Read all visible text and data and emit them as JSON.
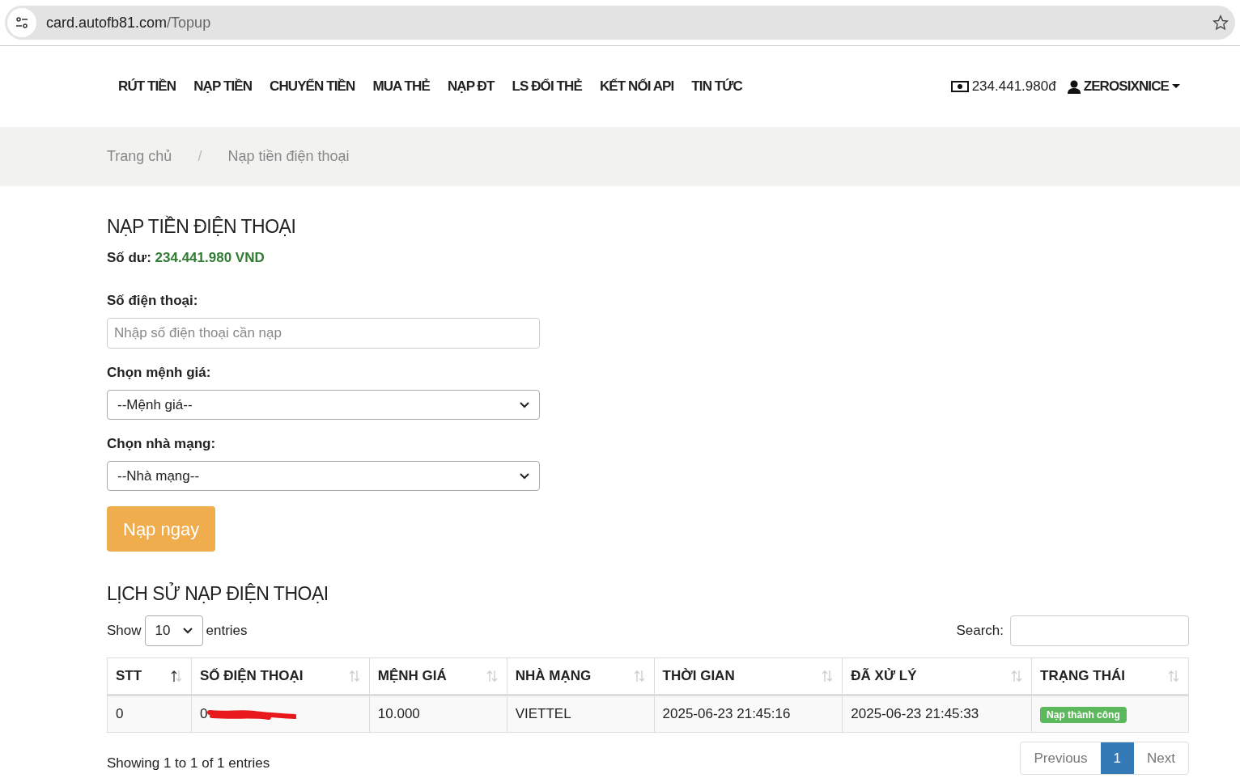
{
  "browser": {
    "url_host": "card.autofb81.com",
    "url_path": "/Topup"
  },
  "nav": {
    "items": [
      "RÚT TIỀN",
      "NẠP TIỀN",
      "CHUYỂN TIỀN",
      "MUA THẺ",
      "NẠP ĐT",
      "LS ĐỔI THẺ",
      "KẾT NỐI API",
      "TIN TỨC"
    ],
    "balance": "234.441.980đ",
    "user": "ZEROSIXNICE"
  },
  "breadcrumb": {
    "items": [
      "Trang chủ",
      "Nạp tiền điện thoại"
    ],
    "separator": "/"
  },
  "form": {
    "title": "NẠP TIỀN ĐIỆN THOẠI",
    "balance_label": "Số dư:",
    "balance_value": "234.441.980 VND",
    "fields": [
      {
        "kind": "input",
        "label": "Số điện thoại:",
        "placeholder": "Nhập số điện thoại cần nạp"
      },
      {
        "kind": "select",
        "label": "Chọn mệnh giá:",
        "value": "--Mệnh giá--"
      },
      {
        "kind": "select",
        "label": "Chọn nhà mạng:",
        "value": "--Nhà mạng--"
      }
    ],
    "submit": "Nạp ngay"
  },
  "history": {
    "title": "LỊCH SỬ NẠP ĐIỆN THOẠI",
    "show_label": "Show",
    "page_size": "10",
    "entries_label": "entries",
    "search_label": "Search:",
    "columns": [
      {
        "label": "STT",
        "sorted": true
      },
      {
        "label": "SỐ ĐIỆN THOẠI",
        "sorted": false
      },
      {
        "label": "MỆNH GIÁ",
        "sorted": false
      },
      {
        "label": "NHÀ MẠNG",
        "sorted": false
      },
      {
        "label": "THỜI GIAN",
        "sorted": false
      },
      {
        "label": "ĐÃ XỬ LÝ",
        "sorted": false
      },
      {
        "label": "TRẠNG THÁI",
        "sorted": false
      }
    ],
    "rows": [
      {
        "cells": [
          {
            "text": "0",
            "redacted": false
          },
          {
            "text": "0",
            "redacted": true
          },
          {
            "text": "10.000",
            "redacted": false
          },
          {
            "text": "VIETTEL",
            "redacted": false
          },
          {
            "text": "2025-06-23 21:45:16",
            "redacted": false
          },
          {
            "text": "2025-06-23 21:45:33",
            "redacted": false
          }
        ],
        "status": "Nạp thành công",
        "color": "#5cb85c"
      }
    ],
    "info": "Showing 1 to 1 of 1 entries",
    "pages": [
      {
        "label": "Previous",
        "selected": false
      },
      {
        "label": "1",
        "selected": true
      },
      {
        "label": "Next",
        "selected": false
      }
    ]
  }
}
